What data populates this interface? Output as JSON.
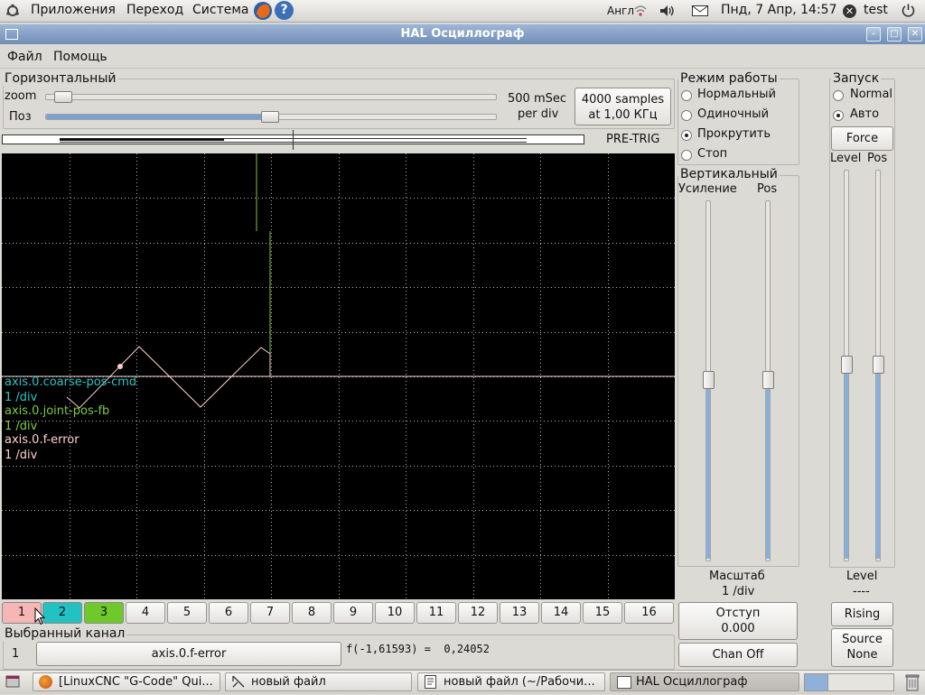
{
  "top_panel": {
    "menus": [
      "Приложения",
      "Переход",
      "Система"
    ],
    "keyboard_layout": "Англ",
    "datetime": "Пнд, 7 Апр, 14:57",
    "user": "test"
  },
  "window": {
    "title": "HAL Осциллограф"
  },
  "menubar": [
    "Файл",
    "Помощь"
  ],
  "horizontal": {
    "frame_label": "Горизонтальный",
    "zoom_label": "zoom",
    "pos_label": "Поз",
    "timescale_value": "500 mSec",
    "timescale_unit": "per div",
    "samples_line1": "4000 samples",
    "samples_line2": "at 1,00 КГц",
    "pretrig_label": "PRE-TRIG",
    "zoom_level": 0.02,
    "pos_level": 0.5
  },
  "mode": {
    "frame_label": "Режим работы",
    "options": [
      "Нормальный",
      "Одиночный",
      "Прокрутить",
      "Стоп"
    ],
    "selected": "Прокрутить"
  },
  "trigger": {
    "frame_label": "Запуск",
    "options": [
      "Normal",
      "Авто"
    ],
    "selected": "Авто",
    "force_label": "Force",
    "level_label": "Level",
    "pos_label": "Pos",
    "level_caption": "Level",
    "level_value": "----",
    "rising_label": "Rising",
    "source_label": "Source",
    "source_value": "None",
    "level_level": 0.5,
    "pos_level": 0.5
  },
  "vertical": {
    "frame_label": "Вертикальный",
    "gain_label": "Усиление",
    "pos_label": "Pos",
    "scale_label": "Масштаб",
    "scale_value": "1 /div",
    "offset_label": "Отступ",
    "offset_value": "0.000",
    "chan_off_label": "Chan Off",
    "gain_level": 0.5,
    "pos_level": 0.5
  },
  "scope": {
    "background": "#000000",
    "grid_color": "#b0b0b0",
    "baseline_color": "#ffd9d9",
    "channels": [
      {
        "name": "axis.0.coarse-pos-cmd",
        "scale": "1 /div",
        "color": "#29c4c4"
      },
      {
        "name": "axis.0.joint-pos-fb",
        "scale": "1 /div",
        "color": "#7ccc3d"
      },
      {
        "name": "axis.0.f-error",
        "scale": "1 /div",
        "color": "#ffd0d0"
      }
    ]
  },
  "channel_buttons": [
    {
      "label": "1",
      "color": "#f7b6b6"
    },
    {
      "label": "2",
      "color": "#22c2c2"
    },
    {
      "label": "3",
      "color": "#6fc92b"
    },
    {
      "label": "4",
      "color": ""
    },
    {
      "label": "5",
      "color": ""
    },
    {
      "label": "6",
      "color": ""
    },
    {
      "label": "7",
      "color": ""
    },
    {
      "label": "8",
      "color": ""
    },
    {
      "label": "9",
      "color": ""
    },
    {
      "label": "10",
      "color": ""
    },
    {
      "label": "11",
      "color": ""
    },
    {
      "label": "12",
      "color": ""
    },
    {
      "label": "13",
      "color": ""
    },
    {
      "label": "14",
      "color": ""
    },
    {
      "label": "15",
      "color": ""
    },
    {
      "label": "16",
      "color": ""
    }
  ],
  "selected_channel": {
    "frame_label": "Выбранный канал",
    "number": "1",
    "name": "axis.0.f-error",
    "readout": "f(-1,61593) =  0,24052"
  },
  "taskbar": {
    "tasks": [
      {
        "label": "[LinuxCNC \"G-Code\" Qui...",
        "icon": "firefox-icon"
      },
      {
        "label": "новый файл",
        "icon": "drawing-icon"
      },
      {
        "label": "новый файл (~/Рабочи...",
        "icon": "text-editor-icon"
      },
      {
        "label": "HAL Осциллограф",
        "icon": "window-icon"
      }
    ]
  }
}
